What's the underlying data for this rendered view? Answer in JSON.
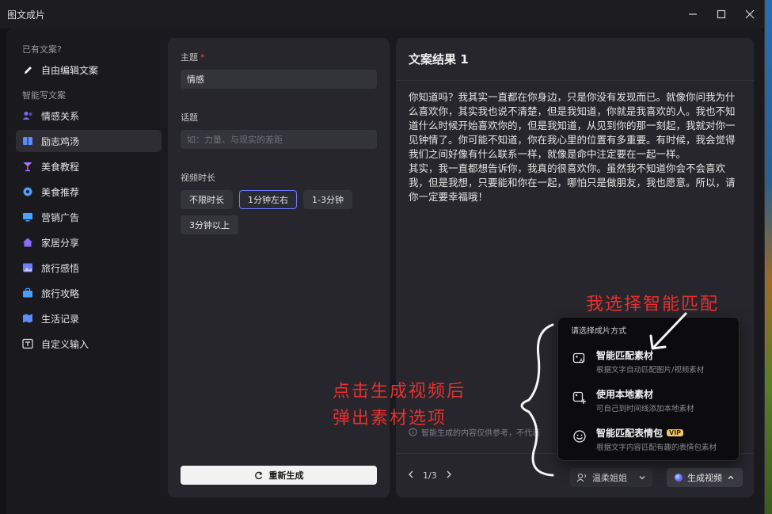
{
  "window": {
    "title": "图文成片"
  },
  "sidebar": {
    "section1": "已有文案?",
    "edit_item": "自由编辑文案",
    "section2": "智能写文案",
    "items": [
      {
        "label": "情感关系",
        "icon": "users-icon",
        "color": "#7b6cff"
      },
      {
        "label": "励志鸡汤",
        "icon": "book-icon",
        "color": "#5b8cff"
      },
      {
        "label": "美食教程",
        "icon": "cocktail-icon",
        "color": "#b86cff"
      },
      {
        "label": "美食推荐",
        "icon": "flower-icon",
        "color": "#4f9dff"
      },
      {
        "label": "营销广告",
        "icon": "monitor-icon",
        "color": "#4aa3ff"
      },
      {
        "label": "家居分享",
        "icon": "home-icon",
        "color": "#8a6cff"
      },
      {
        "label": "旅行感悟",
        "icon": "picture-icon",
        "color": "#6f7dff"
      },
      {
        "label": "旅行攻略",
        "icon": "suitcase-icon",
        "color": "#4a9cff"
      },
      {
        "label": "生活记录",
        "icon": "map-icon",
        "color": "#5a8cff"
      },
      {
        "label": "自定义输入",
        "icon": "text-box-icon",
        "color": "#e6e6e6"
      }
    ],
    "active_index": 1
  },
  "form": {
    "topic_label": "主题",
    "topic_required": "*",
    "topic_value": "情感",
    "title_label": "话题",
    "title_placeholder": "如：力量、与现实的差距",
    "duration_label": "视频时长",
    "durations": [
      "不限时长",
      "1分钟左右",
      "1-3分钟",
      "3分钟以上"
    ],
    "selected_duration": 1,
    "regen_label": "重新生成"
  },
  "result": {
    "title": "文案结果 1",
    "paragraph1": "你知道吗？我其实一直都在你身边，只是你没有发现而已。就像你问我为什么喜欢你，其实我也说不清楚，但是我知道，你就是我喜欢的人。我也不知道什么时候开始喜欢你的，但是我知道，从见到你的那一刻起，我就对你一见钟情了。你可能不知道，你在我心里的位置有多重要。有时候，我会觉得我们之间好像有什么联系一样，就像是命中注定要在一起一样。",
    "paragraph2": "其实，我一直都想告诉你，我真的很喜欢你。虽然我不知道你会不会喜欢我，但是我想，只要能和你在一起，哪怕只是做朋友，我也愿意。所以，请你一定要幸福哦！",
    "disclaimer": "智能生成的内容仅供参考，不代表",
    "page": "1/3",
    "voice": "温柔姐姐",
    "generate_label": "生成视频"
  },
  "popup": {
    "title": "请选择成片方式",
    "options": [
      {
        "title": "智能匹配素材",
        "desc": "根据文字自动匹配图片/视频素材",
        "icon": "ai-image-icon"
      },
      {
        "title": "使用本地素材",
        "desc": "可自己到时间线添加本地素材",
        "icon": "add-image-icon"
      },
      {
        "title": "智能匹配表情包",
        "desc": "根据文字内容匹配有趣的表情包素材",
        "icon": "smile-icon",
        "badge": "VIP"
      }
    ]
  },
  "annotations": {
    "top_note": "我选择智能匹配",
    "left_note_line1": "点击生成视频后",
    "left_note_line2": "弹出素材选项"
  }
}
